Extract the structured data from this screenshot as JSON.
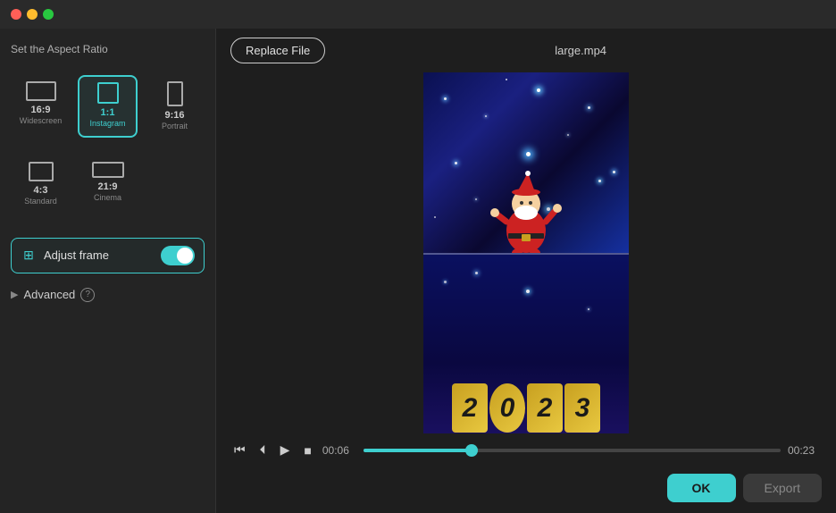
{
  "titlebar": {
    "traffic_lights": [
      "red",
      "yellow",
      "green"
    ]
  },
  "left_panel": {
    "section_title": "Set the Aspect Ratio",
    "aspect_ratios": [
      {
        "ratio": "16:9",
        "name": "Widescreen",
        "selected": false,
        "icon": "widescreen"
      },
      {
        "ratio": "1:1",
        "name": "Instagram",
        "selected": true,
        "icon": "square"
      },
      {
        "ratio": "9:16",
        "name": "Portrait",
        "selected": false,
        "icon": "portrait"
      },
      {
        "ratio": "4:3",
        "name": "Standard",
        "selected": false,
        "icon": "standard"
      },
      {
        "ratio": "21:9",
        "name": "Cinema",
        "selected": false,
        "icon": "cinema"
      }
    ],
    "adjust_frame": {
      "label": "Adjust frame",
      "enabled": true
    },
    "advanced": {
      "label": "Advanced",
      "help": "?"
    }
  },
  "top_bar": {
    "replace_btn": "Replace File",
    "file_name": "large.mp4"
  },
  "controls": {
    "time_current": "00:06",
    "time_total": "00:23",
    "progress_percent": 26
  },
  "actions": {
    "ok_label": "OK",
    "export_label": "Export"
  }
}
